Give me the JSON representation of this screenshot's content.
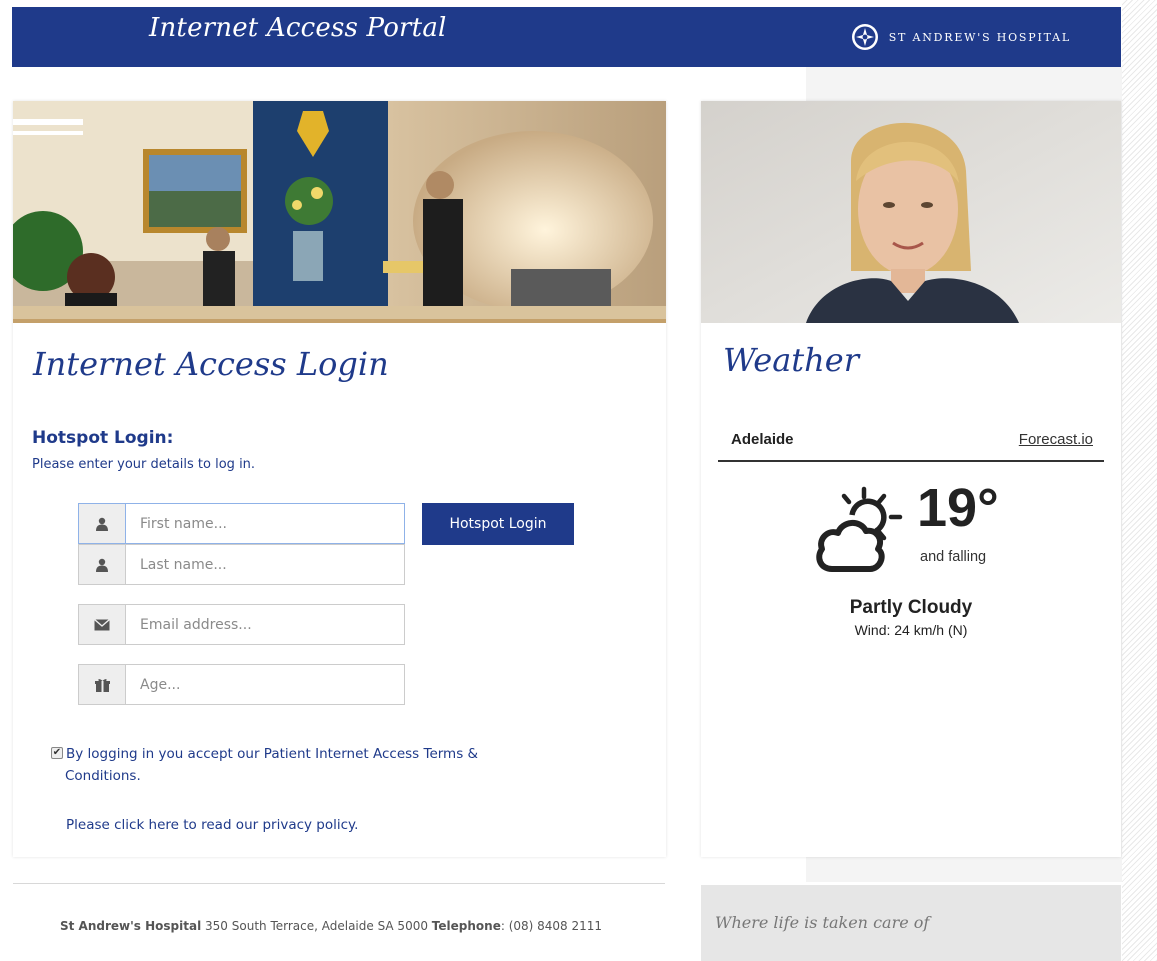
{
  "header": {
    "title": "Internet Access Portal",
    "brand": "ST ANDREW'S HOSPITAL",
    "logo_icon": "crest-icon"
  },
  "login": {
    "heading": "Internet Access Login",
    "hotspot_title": "Hotspot Login:",
    "hotspot_sub": "Please enter your details to log in.",
    "first_name": {
      "value": "",
      "placeholder": "First name...",
      "icon": "user-icon"
    },
    "last_name": {
      "value": "",
      "placeholder": "Last name...",
      "icon": "user-icon"
    },
    "email": {
      "value": "",
      "placeholder": "Email address...",
      "icon": "envelope-icon"
    },
    "age": {
      "value": "",
      "placeholder": "Age...",
      "icon": "gift-icon"
    },
    "button": "Hotspot Login",
    "terms_checked": true,
    "terms_line1": "By logging in you accept our Patient Internet Access Terms &",
    "terms_line2": "Conditions.",
    "privacy": "Please click here to read our privacy policy."
  },
  "weather": {
    "heading": "Weather",
    "city": "Adelaide",
    "source": "Forecast.io",
    "icon": "partly-cloudy-icon",
    "temperature": "19°",
    "trend": "and falling",
    "summary": "Partly Cloudy",
    "wind": "Wind: 24 km/h (N)"
  },
  "footer": {
    "org": "St Andrew's Hospital",
    "address": "350 South Terrace, Adelaide SA 5000",
    "phone_label": "Telephone",
    "phone": ": (08) 8408 2111",
    "tagline": "Where life is taken care of"
  },
  "colors": {
    "brand_blue": "#1f3a8a",
    "header_text": "#ffffff",
    "panel_bg": "#ffffff",
    "page_gray": "#f4f4f4"
  }
}
